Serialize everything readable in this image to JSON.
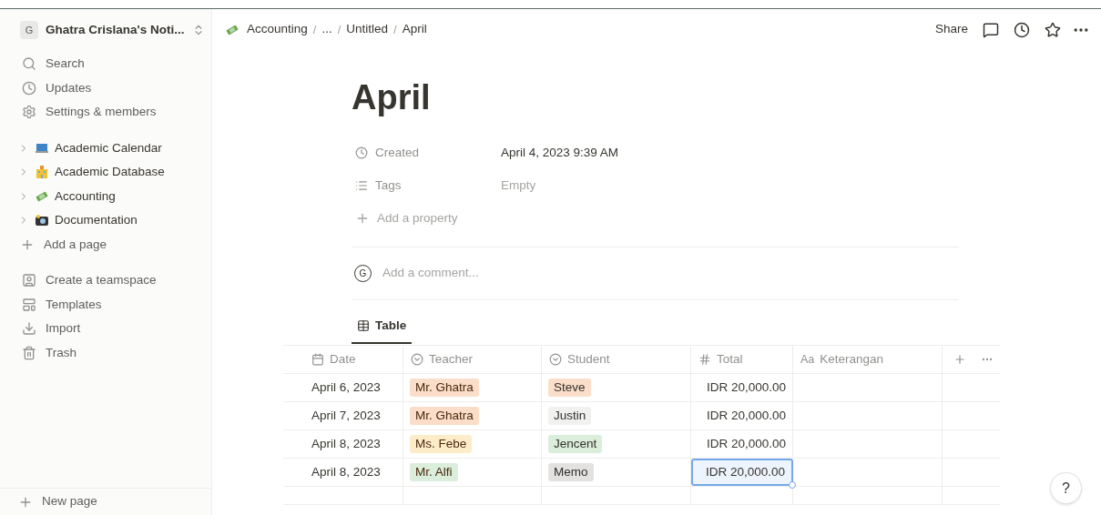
{
  "workspace": {
    "initial": "G",
    "name": "Ghatra Crislana's Noti..."
  },
  "sidebar": {
    "items": [
      {
        "kind": "action",
        "label": "Search"
      },
      {
        "kind": "action",
        "label": "Updates"
      },
      {
        "kind": "action",
        "label": "Settings & members"
      },
      {
        "kind": "page",
        "label": "Academic Calendar"
      },
      {
        "kind": "page",
        "label": "Academic Database"
      },
      {
        "kind": "page",
        "label": "Accounting"
      },
      {
        "kind": "page",
        "label": "Documentation"
      },
      {
        "kind": "add",
        "label": "Add a page"
      },
      {
        "kind": "action",
        "label": "Create a teamspace"
      },
      {
        "kind": "action",
        "label": "Templates"
      },
      {
        "kind": "action",
        "label": "Import"
      },
      {
        "kind": "action",
        "label": "Trash"
      }
    ],
    "new_page": "New page"
  },
  "breadcrumb": [
    "Accounting",
    "...",
    "Untitled",
    "April"
  ],
  "breadcrumb_separator": "/",
  "topbar": {
    "share": "Share"
  },
  "page": {
    "title": "April",
    "properties": [
      {
        "name": "Created",
        "value": "April 4, 2023 9:39 AM",
        "empty": false
      },
      {
        "name": "Tags",
        "value": "Empty",
        "empty": true
      }
    ],
    "add_property": "Add a property",
    "comment_avatar": "G",
    "comment_placeholder": "Add a comment..."
  },
  "view_tab": {
    "label": "Table",
    "selected": true
  },
  "table": {
    "columns": [
      "Date",
      "Teacher",
      "Student",
      "Total",
      "Keterangan"
    ],
    "text_column_icon": "Aa",
    "rows": [
      {
        "date": "April 6, 2023",
        "teacher": {
          "text": "Mr. Ghatra",
          "color": "#fadec9"
        },
        "student": {
          "text": "Steve",
          "color": "#fadec9"
        },
        "total": "IDR 20,000.00",
        "selected": false
      },
      {
        "date": "April 7, 2023",
        "teacher": {
          "text": "Mr. Ghatra",
          "color": "#fadec9"
        },
        "student": {
          "text": "Justin",
          "color": "#f1f1ef"
        },
        "total": "IDR 20,000.00",
        "selected": false
      },
      {
        "date": "April 8, 2023",
        "teacher": {
          "text": "Ms. Febe",
          "color": "#fdecc8"
        },
        "student": {
          "text": "Jencent",
          "color": "#dbeddb"
        },
        "total": "IDR 20,000.00",
        "selected": false
      },
      {
        "date": "April 8, 2023",
        "teacher": {
          "text": "Mr. Alfi",
          "color": "#dbeddb"
        },
        "student": {
          "text": "Memo",
          "color": "#e3e2e0"
        },
        "total": "IDR 20,000.00",
        "selected": true
      }
    ]
  },
  "help": "?"
}
